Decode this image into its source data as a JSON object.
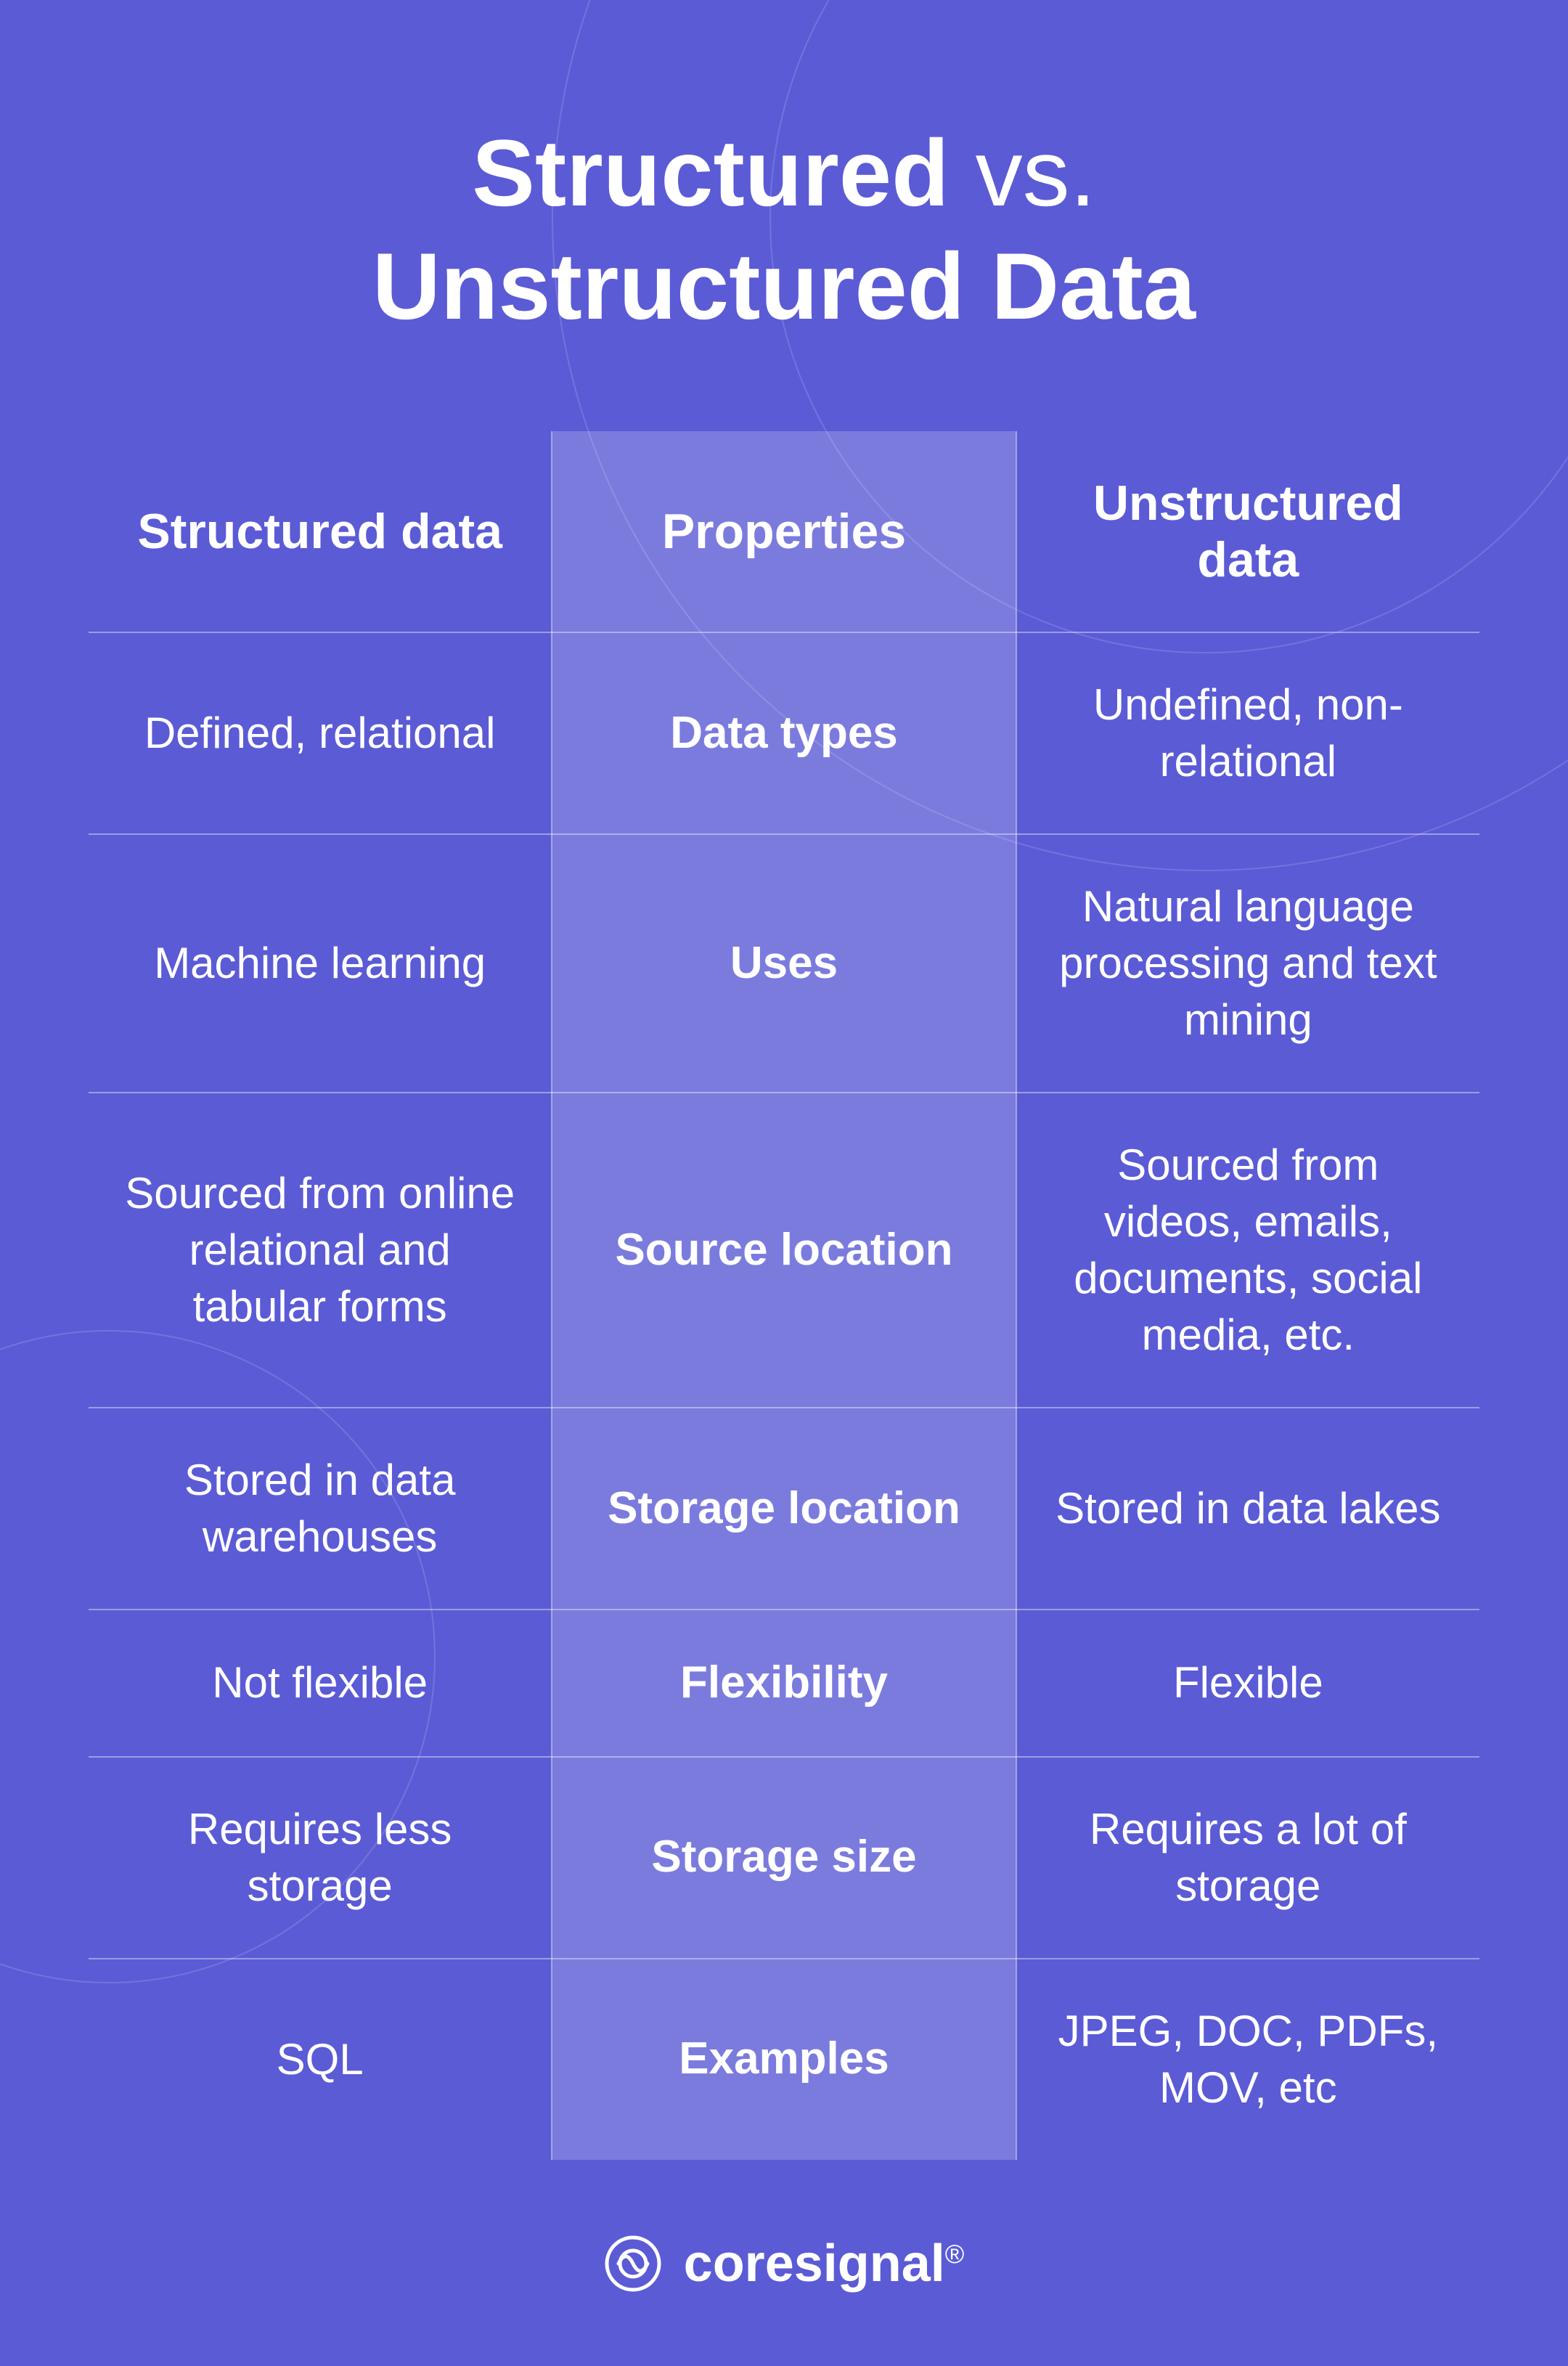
{
  "title": {
    "line1_normal": "Structured",
    "line1_vs": " vs.",
    "line2_bold": "Unstructured Data"
  },
  "table": {
    "headers": {
      "left": "Structured data",
      "middle": "Properties",
      "right": "Unstructured data"
    },
    "rows": [
      {
        "left": "Defined, relational",
        "middle": "Data types",
        "right": "Undefined, non-relational"
      },
      {
        "left": "Machine learning",
        "middle": "Uses",
        "right": "Natural language processing and text mining"
      },
      {
        "left": "Sourced from online relational and tabular forms",
        "middle": "Source location",
        "right": "Sourced from videos, emails, documents, social media, etc."
      },
      {
        "left": "Stored in data warehouses",
        "middle": "Storage location",
        "right": "Stored in data lakes"
      },
      {
        "left": "Not flexible",
        "middle": "Flexibility",
        "right": "Flexible"
      },
      {
        "left": "Requires less storage",
        "middle": "Storage size",
        "right": "Requires a lot of storage"
      },
      {
        "left": "SQL",
        "middle": "Examples",
        "right": "JPEG, DOC, PDFs, MOV, etc"
      }
    ]
  },
  "footer": {
    "brand": "coresignal",
    "trademark": "®"
  }
}
